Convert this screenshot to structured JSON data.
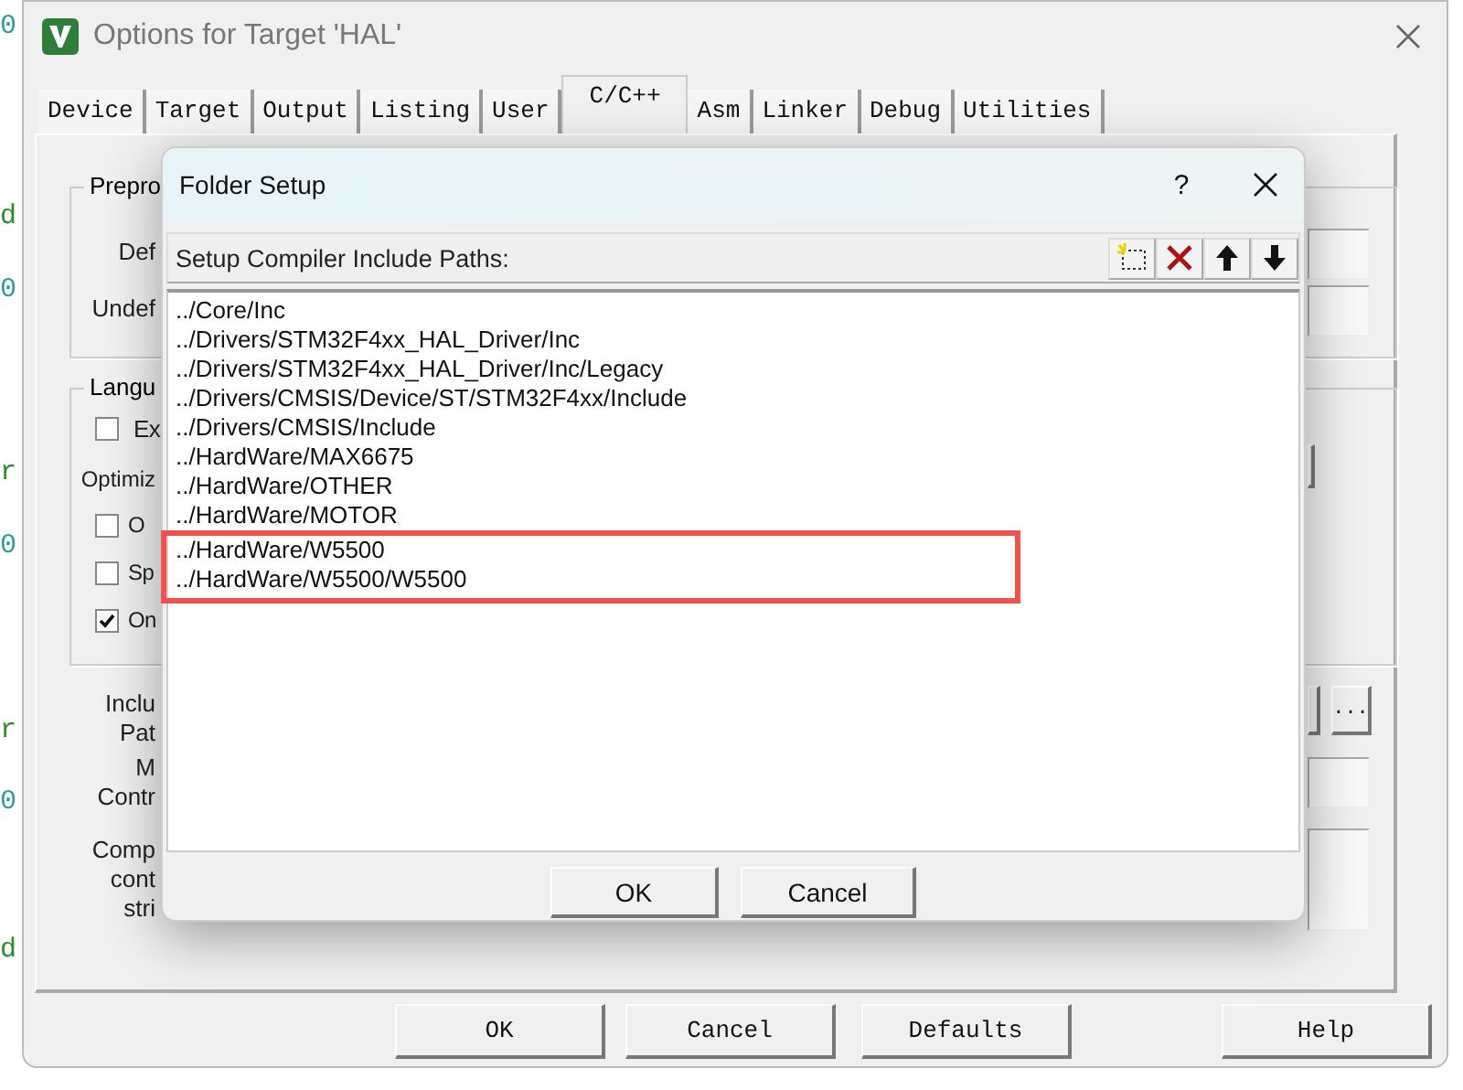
{
  "editor_fragments": [
    {
      "text": "0",
      "color": "#2a9d9d"
    },
    {
      "text": "d",
      "color": "#2e8b2e"
    },
    {
      "text": "0",
      "color": "#2a9d9d"
    },
    {
      "text": "r",
      "color": "#2e8b2e"
    },
    {
      "text": "0",
      "color": "#2a9d9d"
    },
    {
      "text": "r",
      "color": "#2e8b2e"
    },
    {
      "text": "0",
      "color": "#2a9d9d"
    },
    {
      "text": "d",
      "color": "#2e8b2e"
    }
  ],
  "window": {
    "title": "Options for Target 'HAL'",
    "tabs": [
      {
        "label": "Device",
        "selected": false
      },
      {
        "label": "Target",
        "selected": false
      },
      {
        "label": "Output",
        "selected": false
      },
      {
        "label": "Listing",
        "selected": false
      },
      {
        "label": "User",
        "selected": false
      },
      {
        "label": "C/C++",
        "selected": true
      },
      {
        "label": "Asm",
        "selected": false
      },
      {
        "label": "Linker",
        "selected": false
      },
      {
        "label": "Debug",
        "selected": false
      },
      {
        "label": "Utilities",
        "selected": false
      }
    ],
    "preprocessor_group": {
      "title": "Prepro",
      "labels": [
        "Def",
        "Undef"
      ]
    },
    "language_group": {
      "title": "Langu",
      "checkboxes": [
        {
          "label": "Ex",
          "checked": false
        }
      ],
      "optimization_label": "Optimiz",
      "options": [
        {
          "label": "O",
          "checked": false
        },
        {
          "label": "Sp",
          "checked": false
        },
        {
          "label": "On",
          "checked": true
        }
      ]
    },
    "include_label": [
      "Inclu",
      "Pat"
    ],
    "browse_button": "...",
    "misc_label": [
      "M",
      "Contr"
    ],
    "compiler_label": [
      "Comp",
      "cont",
      "stri"
    ],
    "buttons": [
      "OK",
      "Cancel",
      "Defaults",
      "Help"
    ]
  },
  "folder_setup": {
    "title": "Folder Setup",
    "help": "?",
    "header": "Setup Compiler Include Paths:",
    "paths": [
      {
        "text": "../Core/Inc",
        "highlighted": false
      },
      {
        "text": "../Drivers/STM32F4xx_HAL_Driver/Inc",
        "highlighted": false
      },
      {
        "text": "../Drivers/STM32F4xx_HAL_Driver/Inc/Legacy",
        "highlighted": false
      },
      {
        "text": "../Drivers/CMSIS/Device/ST/STM32F4xx/Include",
        "highlighted": false
      },
      {
        "text": "../Drivers/CMSIS/Include",
        "highlighted": false
      },
      {
        "text": "../HardWare/MAX6675",
        "highlighted": false
      },
      {
        "text": "../HardWare/OTHER",
        "highlighted": false
      },
      {
        "text": "../HardWare/MOTOR",
        "highlighted": false
      },
      {
        "text": "../HardWare/W5500",
        "highlighted": true
      },
      {
        "text": "../HardWare/W5500/W5500",
        "highlighted": true
      }
    ],
    "buttons": [
      "OK",
      "Cancel"
    ]
  }
}
